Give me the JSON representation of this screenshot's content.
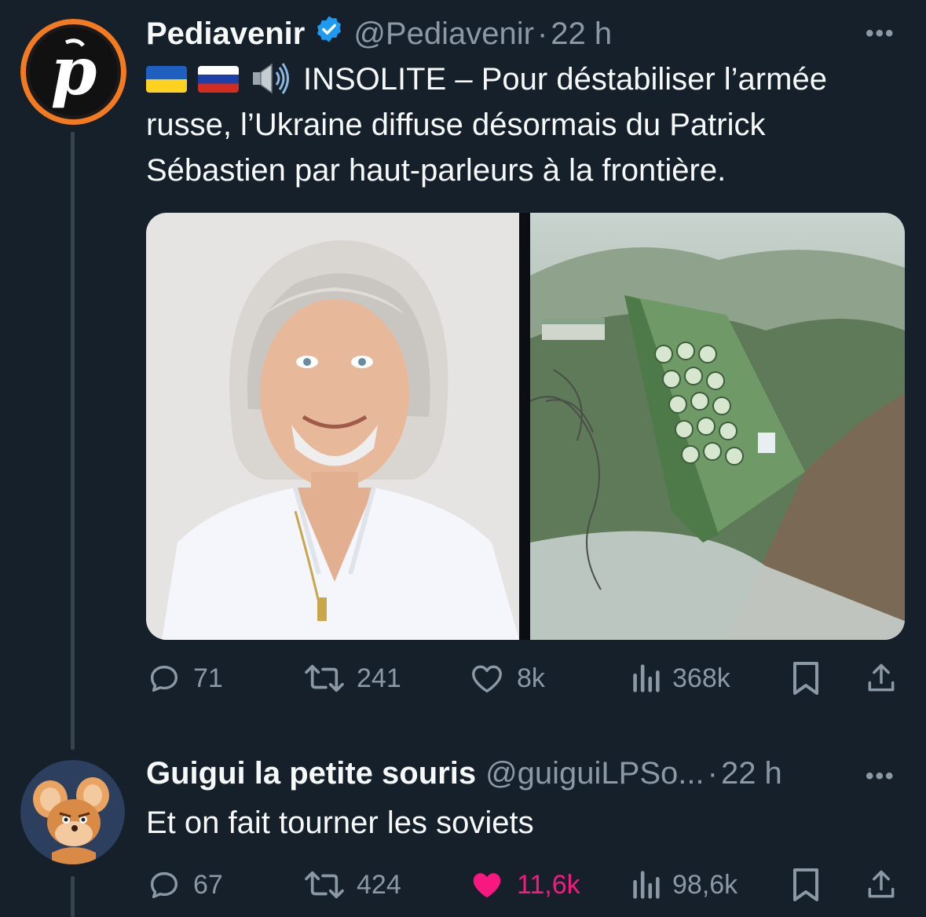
{
  "tweet": {
    "author_name": "Pediavenir",
    "handle": "@Pediavenir",
    "separator": "·",
    "time": "22 h",
    "more": "•••",
    "text_line1": "INSOLITE – Pour déstabiliser l’armée",
    "text_line2": "russe, l’Ukraine diffuse désormais du Patrick",
    "text_line3": "Sébastien par haut-parleurs à la frontière.",
    "replies": "71",
    "retweets": "241",
    "likes": "8k",
    "views": "368k"
  },
  "reply": {
    "author_name": "Guigui la petite souris",
    "handle": "@guiguiLPSo...",
    "separator": "·",
    "time": "22 h",
    "more": "•••",
    "text": "Et on fait tourner les soviets",
    "replies": "67",
    "retweets": "424",
    "likes": "11,6k",
    "views": "98,6k"
  },
  "colors": {
    "background": "#15202b",
    "text": "#f7f9f9",
    "muted": "#8b98a5",
    "verified": "#1d9bf0",
    "liked": "#f91880",
    "avatar_ring": "#f47a20"
  },
  "icons": [
    "verified-badge-icon",
    "speaker-icon",
    "reply-icon",
    "retweet-icon",
    "like-icon",
    "views-icon",
    "bookmark-icon",
    "share-icon"
  ]
}
